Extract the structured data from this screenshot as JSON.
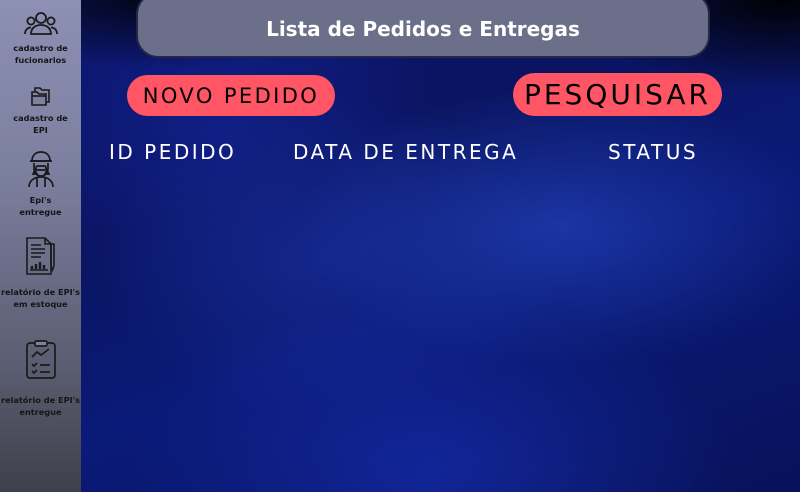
{
  "title": "Lista de Pedidos e Entregas",
  "sidebar": {
    "items": [
      {
        "label": "cadastro de fucionarios",
        "icon": "users-icon"
      },
      {
        "label": "cadastro de EPI",
        "icon": "folders-icon"
      },
      {
        "label": "Epi's entregue",
        "icon": "protective-worker-icon"
      },
      {
        "label": "relatório de EPI's em estoque",
        "icon": "report-chart-icon"
      },
      {
        "label": "relatório de EPI's entregue",
        "icon": "clipboard-checklist-icon"
      }
    ]
  },
  "toolbar": {
    "new_order_label": "NOVO PEDIDO",
    "search_label": "PESQUISAR"
  },
  "table": {
    "columns": [
      "ID PEDIDO",
      "DATA DE ENTREGA",
      "STATUS"
    ]
  },
  "colors": {
    "accent": "#ff5564",
    "title_bar": "#6c6f8a",
    "background": "#0a1460"
  }
}
